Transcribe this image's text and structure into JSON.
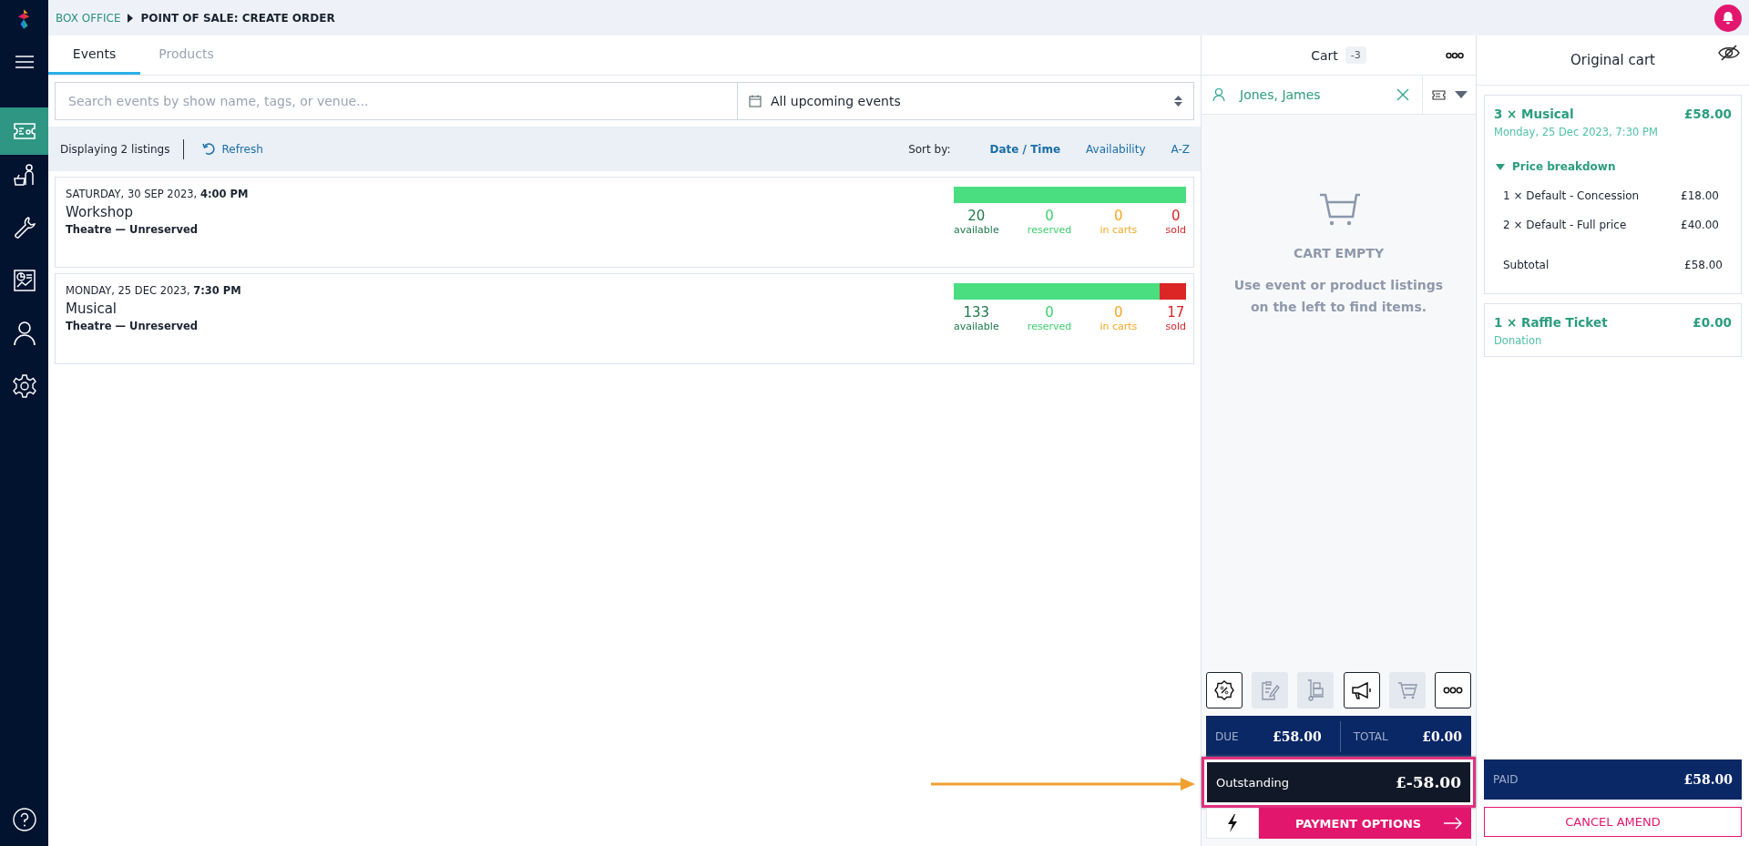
{
  "breadcrumb": {
    "parent": "BOX OFFICE",
    "current": "POINT OF SALE: CREATE ORDER"
  },
  "sidebar": {
    "items": [
      {
        "kind": "menu",
        "selected": false
      },
      {
        "kind": "tickets",
        "selected": true
      },
      {
        "kind": "basket",
        "selected": false
      },
      {
        "kind": "wrench",
        "selected": false
      },
      {
        "kind": "report",
        "selected": false
      },
      {
        "kind": "person",
        "selected": false
      },
      {
        "kind": "settings",
        "selected": false
      }
    ]
  },
  "tabs": [
    {
      "label": "Events",
      "selected": true
    },
    {
      "label": "Products",
      "selected": false
    }
  ],
  "search": {
    "placeholder": "Search events by show name, tags, or venue..."
  },
  "date_filter": {
    "value": "All upcoming events"
  },
  "listing_bar": {
    "count": "Displaying 2 listings",
    "refresh": "Refresh",
    "sort_label": "Sort by:",
    "sort_options": [
      {
        "label": "Date / Time",
        "selected": true
      },
      {
        "label": "Availability",
        "selected": false
      },
      {
        "label": "A-Z",
        "selected": false
      }
    ]
  },
  "events": [
    {
      "day": "SATURDAY, 30 SEP 2023,",
      "time": "4:00 PM",
      "name": "Workshop",
      "venue": "Theatre — Unreserved",
      "bar": {
        "level": 1
      },
      "stats": [
        {
          "kind": "available",
          "value": "20",
          "label": "available"
        },
        {
          "kind": "reserved",
          "value": "0",
          "label": "reserved"
        },
        {
          "kind": "in_carts",
          "value": "0",
          "label": "in carts"
        },
        {
          "kind": "sold",
          "value": "0",
          "label": "sold"
        }
      ]
    },
    {
      "day": "MONDAY, 25 DEC 2023,",
      "time": "7:30 PM",
      "name": "Musical",
      "venue": "Theatre — Unreserved",
      "bar": {
        "level": 0.887
      },
      "stats": [
        {
          "kind": "available",
          "value": "133",
          "label": "available"
        },
        {
          "kind": "reserved",
          "value": "0",
          "label": "reserved"
        },
        {
          "kind": "in_carts",
          "value": "0",
          "label": "in carts"
        },
        {
          "kind": "sold",
          "value": "17",
          "label": "sold"
        }
      ]
    }
  ],
  "cart": {
    "title": "Cart",
    "count": "-3",
    "customer": "Jones, James",
    "empty_title": "CART EMPTY",
    "empty_message": "Use event or product listings on the left to find items.",
    "tools": [
      {
        "kind": "discount",
        "disabled": false
      },
      {
        "kind": "notes",
        "disabled": true
      },
      {
        "kind": "delivery",
        "disabled": true
      },
      {
        "kind": "promote",
        "disabled": false
      },
      {
        "kind": "basket",
        "disabled": true
      },
      {
        "kind": "more",
        "disabled": false
      }
    ],
    "due_label": "DUE",
    "due": "£58.00",
    "total_label": "TOTAL",
    "total": "£0.00",
    "outstanding": {
      "label": "Outstanding",
      "amount": "£-58.00",
      "highlighted": true
    },
    "payment_button": "PAYMENT OPTIONS"
  },
  "original_cart": {
    "title": "Original cart",
    "items": [
      {
        "title": "3 × Musical",
        "price": "£58.00",
        "subtitle": "Monday, 25 Dec 2023, 7:30 PM",
        "breakdown": {
          "label": "Price breakdown",
          "expanded": true,
          "lines": [
            {
              "label": "1 × Default - Concession",
              "amount": "£18.00"
            },
            {
              "label": "2 × Default - Full price",
              "amount": "£40.00"
            }
          ],
          "subtotal_label": "Subtotal",
          "subtotal": "£58.00"
        }
      },
      {
        "title": "1 × Raffle Ticket",
        "price": "£0.00",
        "subtitle": "Donation"
      }
    ],
    "paid_label": "PAID",
    "paid": "£58.00",
    "cancel_button": "CANCEL AMEND"
  }
}
